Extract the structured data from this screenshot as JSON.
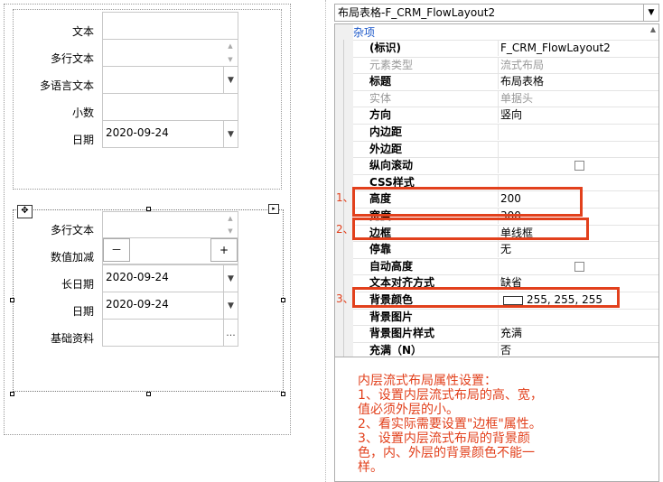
{
  "designer": {
    "upper_fields": [
      {
        "label": "文本",
        "value": "",
        "type": "text"
      },
      {
        "label": "多行文本",
        "value": "",
        "type": "multiline"
      },
      {
        "label": "多语言文本",
        "value": "",
        "type": "dropdown"
      },
      {
        "label": "小数",
        "value": "",
        "type": "text"
      },
      {
        "label": "日期",
        "value": "2020-09-24",
        "type": "dropdown"
      }
    ],
    "inner_fields": [
      {
        "label": "多行文本",
        "value": "",
        "type": "multiline"
      },
      {
        "label": "数值加减",
        "value": "",
        "type": "stepper",
        "minus": "－",
        "plus": "+"
      },
      {
        "label": "长日期",
        "value": "2020-09-24",
        "type": "dropdown"
      },
      {
        "label": "日期",
        "value": "2020-09-24",
        "type": "dropdown"
      },
      {
        "label": "基础资料",
        "value": "",
        "type": "lookup",
        "button": "..."
      }
    ]
  },
  "property_grid": {
    "object_selector": "布局表格-F_CRM_FlowLayout2",
    "category": "杂项",
    "rows": [
      {
        "name": "(标识)",
        "value": "F_CRM_FlowLayout2",
        "disabled": false
      },
      {
        "name": "元素类型",
        "value": "流式布局",
        "disabled": true
      },
      {
        "name": "标题",
        "value": "布局表格",
        "disabled": false
      },
      {
        "name": "实体",
        "value": "单据头",
        "disabled": true
      },
      {
        "name": "方向",
        "value": "竖向",
        "disabled": false
      },
      {
        "name": "内边距",
        "value": "",
        "disabled": false
      },
      {
        "name": "外边距",
        "value": "",
        "disabled": false
      },
      {
        "name": "纵向滚动",
        "value": "",
        "disabled": false,
        "checkbox": true
      },
      {
        "name": "CSS样式",
        "value": "",
        "disabled": false
      },
      {
        "name": "高度",
        "value": "200",
        "disabled": false
      },
      {
        "name": "宽度",
        "value": "300",
        "disabled": false
      },
      {
        "name": "边框",
        "value": "单线框",
        "disabled": false
      },
      {
        "name": "停靠",
        "value": "无",
        "disabled": false
      },
      {
        "name": "自动高度",
        "value": "",
        "disabled": false,
        "checkbox": true
      },
      {
        "name": "文本对齐方式",
        "value": "缺省",
        "disabled": false
      },
      {
        "name": "背景颜色",
        "value": "255, 255, 255",
        "disabled": false,
        "swatch": "#ffffff"
      },
      {
        "name": "背景图片",
        "value": "",
        "disabled": false
      },
      {
        "name": "背景图片样式",
        "value": "充满",
        "disabled": false
      },
      {
        "name": "充满（N）",
        "value": "否",
        "disabled": false
      }
    ]
  },
  "annotations": {
    "markers": [
      "1、",
      "2、",
      "3、"
    ],
    "accent_color": "#e2401c",
    "lines": [
      "内层流式布局属性设置：",
      "1、设置内层流式布局的高、宽，",
      "值必须外层的小。",
      "2、看实际需要设置\"边框\"属性。",
      "3、设置内层流式布局的背景颜",
      "色，内、外层的背景颜色不能一",
      "样。"
    ]
  }
}
